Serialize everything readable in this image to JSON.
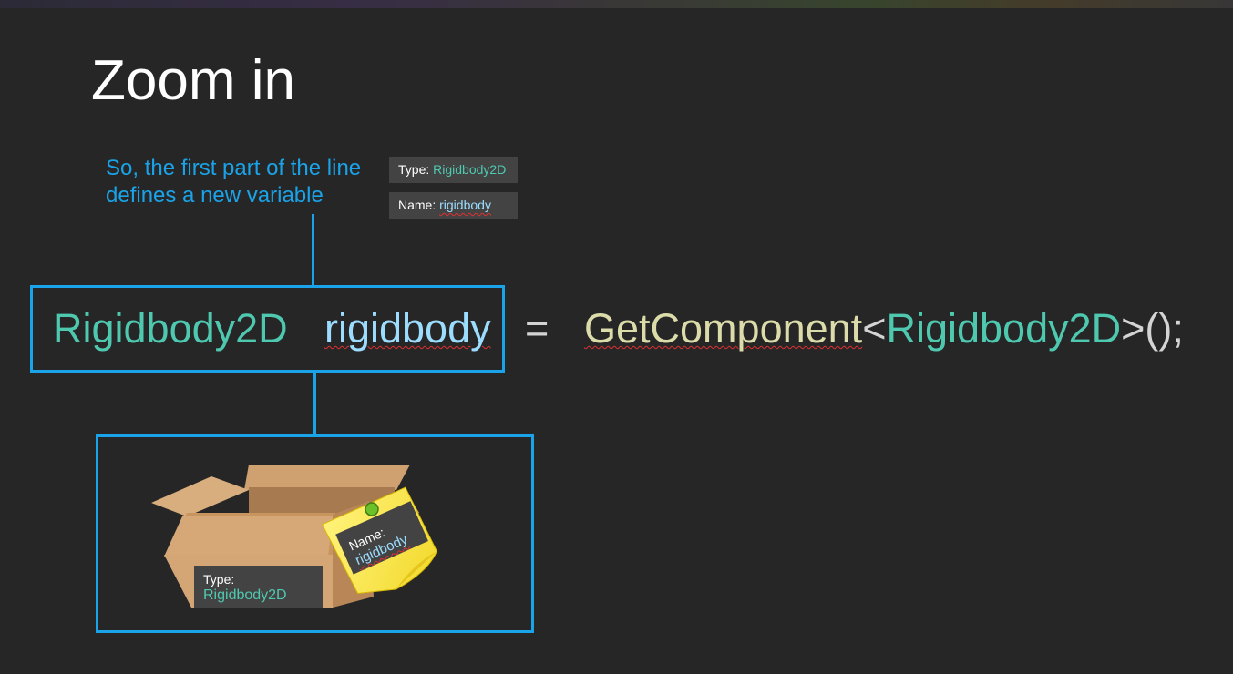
{
  "slide": {
    "title": "Zoom in"
  },
  "callout": {
    "line1": "So, the first part of the line",
    "line2": "defines a new variable"
  },
  "info": {
    "type_label": "Type: ",
    "type_value": "Rigidbody2D",
    "name_label": "Name: ",
    "name_value": "rigidbody"
  },
  "code": {
    "type": "Rigidbody2D",
    "name": "rigidbody",
    "equals": "=",
    "method": "GetComponent",
    "open_angle": "<",
    "generic_type": "Rigidbody2D",
    "close": ">();"
  },
  "illustration": {
    "box_type_label": "Type:",
    "box_type_value": "Rigidbody2D",
    "note_name_label": "Name:",
    "note_name_value": "rigidbody"
  },
  "colors": {
    "background": "#262626",
    "accent_blue": "#1aa3e8",
    "type_teal": "#4ec9b0",
    "variable_lightblue": "#9cdcfe",
    "method_yellow": "#dcdcaa",
    "label_box": "#434343"
  },
  "icons": {
    "box": "cardboard-box-icon",
    "sticky_note": "sticky-note-icon",
    "pin": "pushpin-icon"
  }
}
